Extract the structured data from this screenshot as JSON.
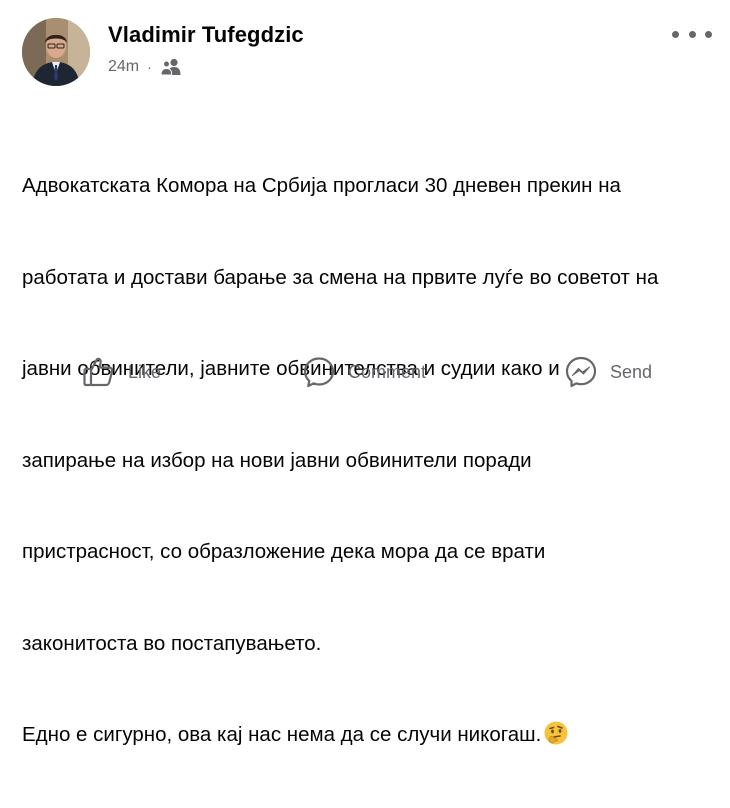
{
  "post": {
    "author_name": "Vladimir Tufegdzic",
    "timestamp": "24m",
    "separator": "·",
    "audience_icon": "friends-icon",
    "more_icon": "more-dots-icon",
    "text_lines": [
      "Адвокатската Комора на Србија прогласи 30 дневен прекин на",
      "работата и достави барање за смена на првите луѓе во советот на",
      "јавни обвинители, јавните обвинителства и судии како и",
      "запирање на избор на нови јавни обвинители поради",
      "пристрасност, со образложение дека мора да се врати",
      "законитоста во постапувањето.",
      "Едно е сигурно, ова кај нас нема да се случи никогаш."
    ],
    "emoji": "thinking-face-icon"
  },
  "actions": {
    "like_label": "Like",
    "comment_label": "Comment",
    "send_label": "Send"
  },
  "colors": {
    "text": "#050505",
    "secondary": "#65676b",
    "background": "#ffffff",
    "emoji": "#f7c33c"
  }
}
